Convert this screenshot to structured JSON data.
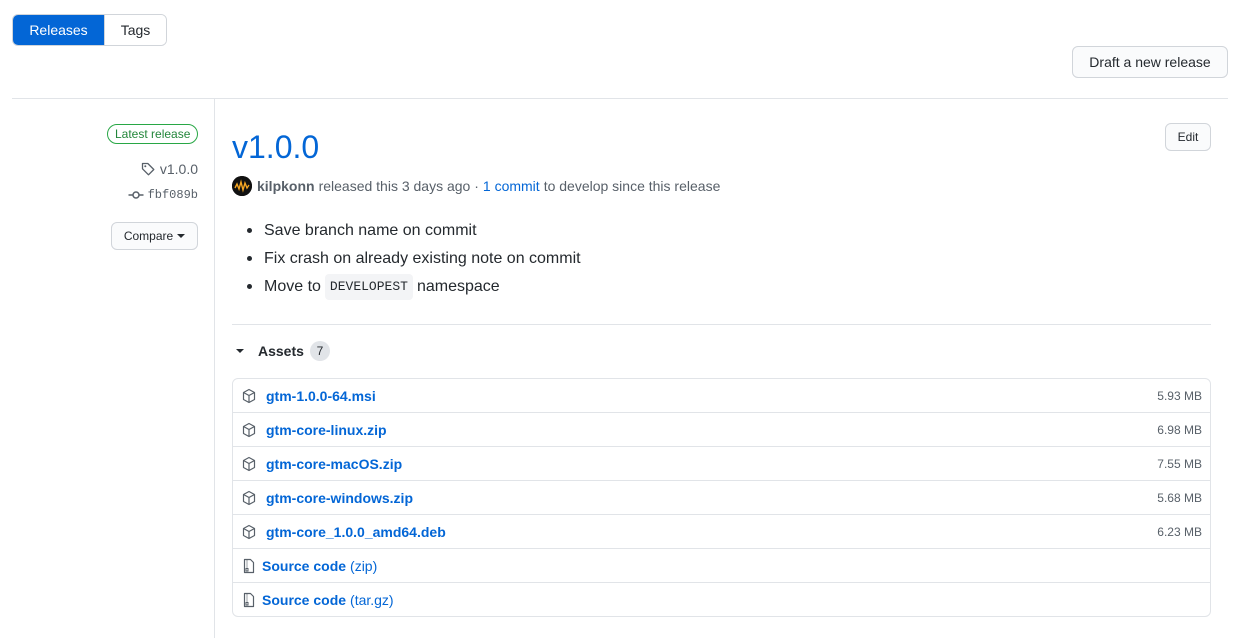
{
  "tabs": [
    {
      "label": "Releases",
      "selected": true
    },
    {
      "label": "Tags",
      "selected": false
    }
  ],
  "draft_button": "Draft a new release",
  "sidebar": {
    "badge": "Latest release",
    "tag": "v1.0.0",
    "commit": "fbf089b",
    "compare_button": "Compare"
  },
  "release": {
    "title": "v1.0.0",
    "edit_button": "Edit",
    "author": "kilpkonn",
    "released_text": "released this 3 days ago ·",
    "commits_link": "1 commit",
    "since_text": "to develop since this release",
    "notes": [
      {
        "text": "Save branch name on commit"
      },
      {
        "text": "Fix crash on already existing note on commit"
      },
      {
        "before": "Move to",
        "code": "DEVELOPEST",
        "after": "namespace"
      }
    ]
  },
  "assets": {
    "label": "Assets",
    "count": "7",
    "files": [
      {
        "name": "gtm-1.0.0-64.msi",
        "size": "5.93 MB"
      },
      {
        "name": "gtm-core-linux.zip",
        "size": "6.98 MB"
      },
      {
        "name": "gtm-core-macOS.zip",
        "size": "7.55 MB"
      },
      {
        "name": "gtm-core-windows.zip",
        "size": "5.68 MB"
      },
      {
        "name": "gtm-core_1.0.0_amd64.deb",
        "size": "6.23 MB"
      }
    ],
    "source": [
      {
        "name": "Source code",
        "suffix": "(zip)"
      },
      {
        "name": "Source code",
        "suffix": "(tar.gz)"
      }
    ]
  },
  "colors": {
    "accent": "#0366d6",
    "latest_green": "#28a745"
  }
}
